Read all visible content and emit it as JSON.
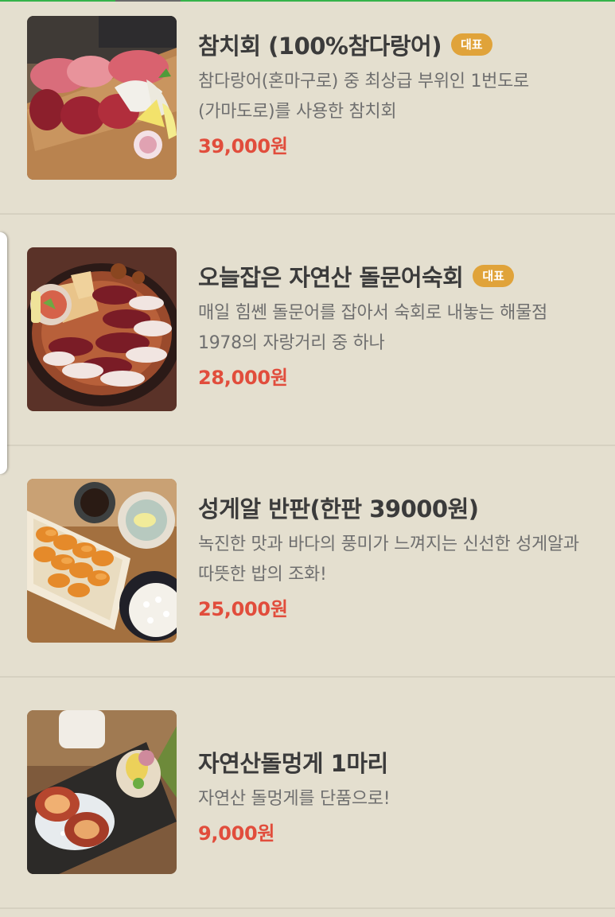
{
  "menu": [
    {
      "name": "참치회 (100%참다랑어)",
      "badge": "대표",
      "description": "참다랑어(혼마구로) 중 최상급 부위인 1번도로(가마도로)를 사용한 참치회",
      "price": "39,000원",
      "photo_icon": "tuna-sashimi-photo"
    },
    {
      "name": "오늘잡은 자연산 돌문어숙회",
      "badge": "대표",
      "description": "매일 힘쎈 돌문어를 잡아서 숙회로 내놓는 해물점 1978의 자랑거리 중 하나",
      "price": "28,000원",
      "photo_icon": "octopus-platter-photo"
    },
    {
      "name": "성게알 반판(한판 39000원)",
      "badge": "",
      "description": "녹진한 맛과 바다의 풍미가 느껴지는 신선한 성게알과 따뜻한 밥의 조화!",
      "price": "25,000원",
      "photo_icon": "sea-urchin-photo"
    },
    {
      "name": "자연산돌멍게 1마리",
      "badge": "",
      "description": "자연산 돌멍게를 단품으로!",
      "price": "9,000원",
      "photo_icon": "sea-squirt-photo"
    }
  ],
  "colors": {
    "background": "#e4dfcf",
    "title": "#3b3b3b",
    "description": "#6f6f6f",
    "price": "#e14d3c",
    "badge": "#e0a33a",
    "top_accent": "#35b34a"
  }
}
